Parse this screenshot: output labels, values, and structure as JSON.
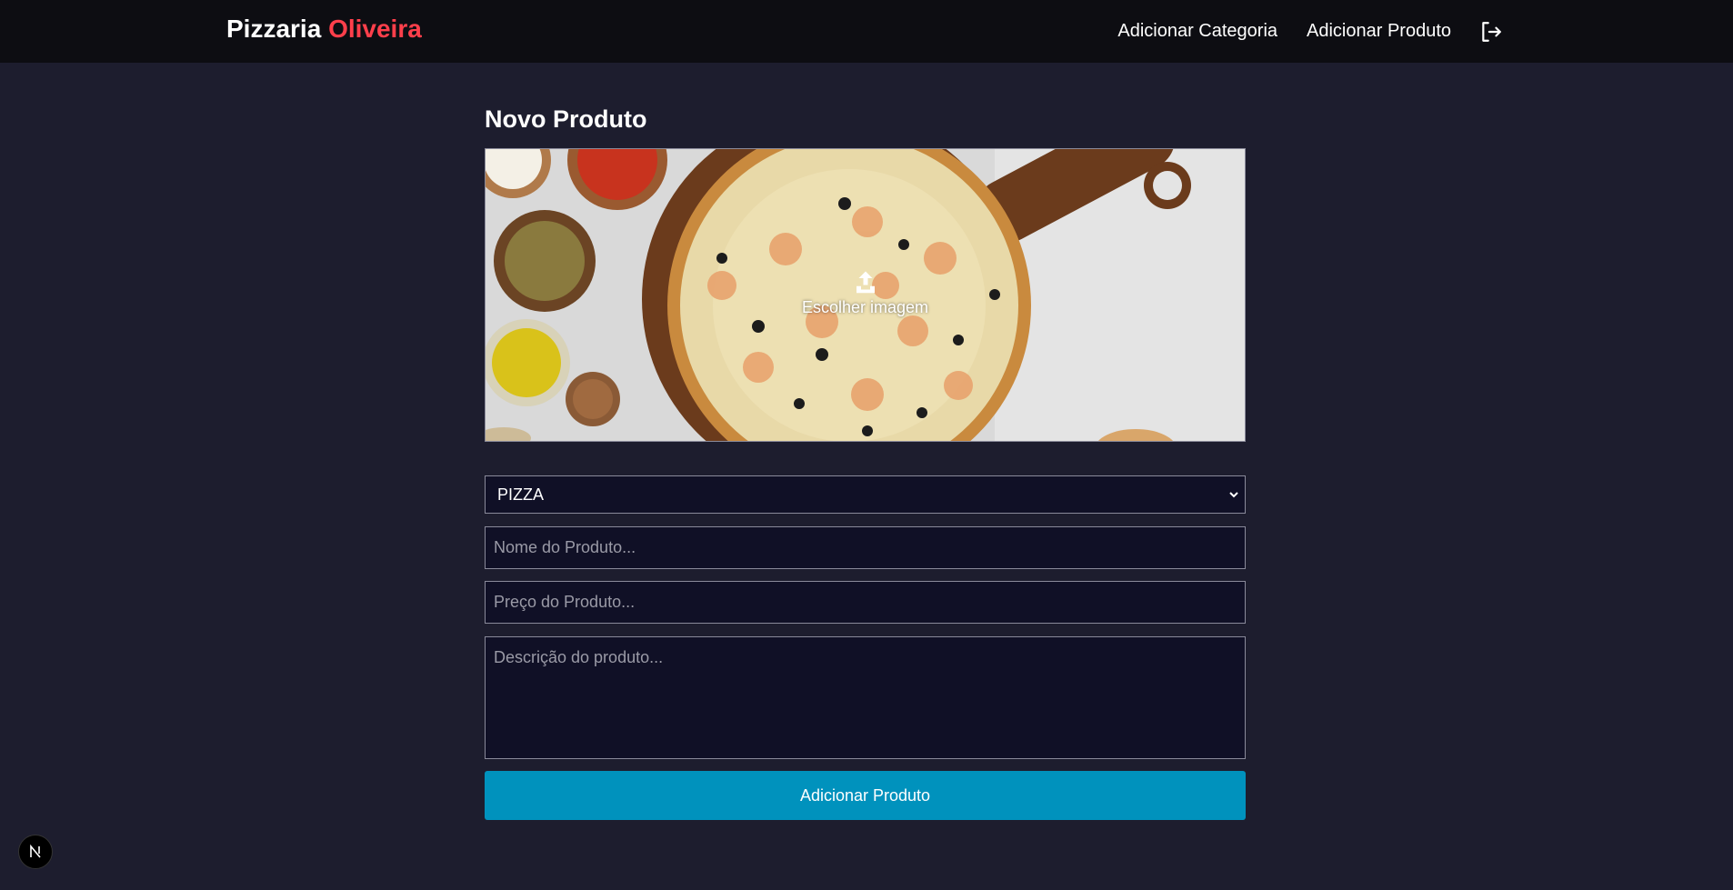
{
  "header": {
    "brand_name": "Pizzaria",
    "brand_accent": "Oliveira",
    "brand_accent_color": "#ff3f4b",
    "nav": [
      {
        "label": "Adicionar Categoria"
      },
      {
        "label": "Adicionar Produto"
      }
    ],
    "logout_icon": "logout-icon"
  },
  "main": {
    "title": "Novo Produto",
    "image_picker": {
      "label": "Escolher imagem",
      "icon": "upload-icon"
    },
    "category_select": {
      "selected": "PIZZA",
      "icon": "chevron-down-icon"
    },
    "name_input": {
      "placeholder": "Nome do Produto...",
      "value": ""
    },
    "price_input": {
      "placeholder": "Preço do Produto...",
      "value": ""
    },
    "description_input": {
      "placeholder": "Descrição do produto...",
      "value": ""
    },
    "submit_label": "Adicionar Produto",
    "submit_color": "#0092bd"
  },
  "dev_badge": {
    "label": "N"
  }
}
